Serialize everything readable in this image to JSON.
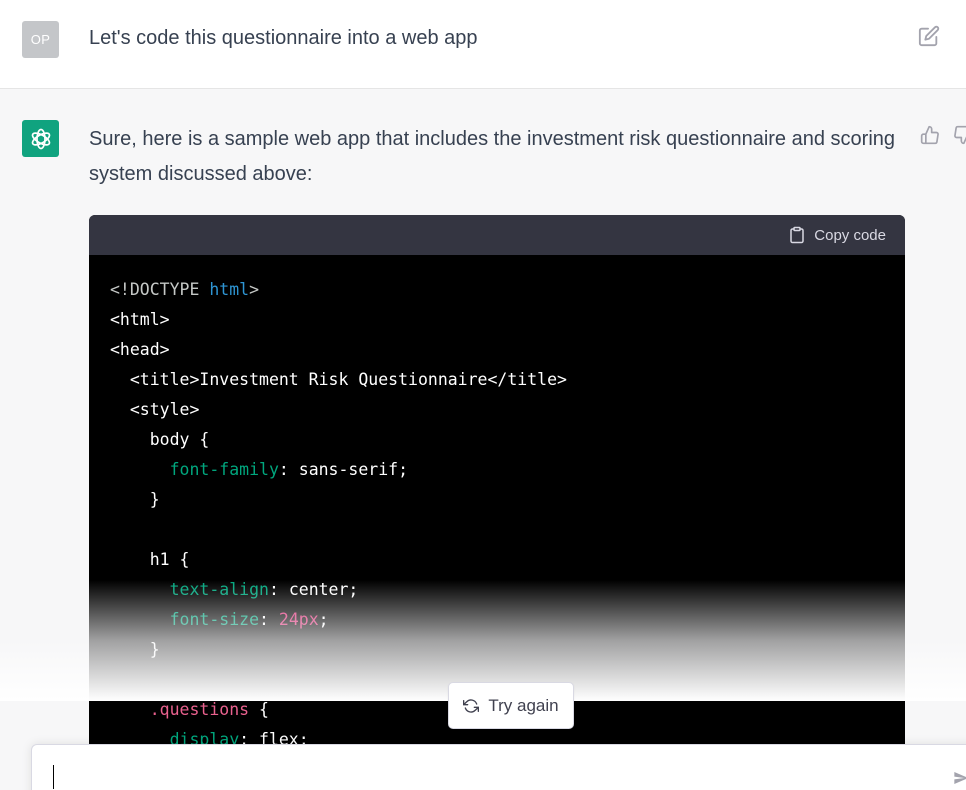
{
  "user_message": {
    "avatar_initials": "OP",
    "text": "Let's code this questionnaire into a web app"
  },
  "assistant_message": {
    "text": "Sure, here is a sample web app that includes the investment risk questionnaire and scoring system discussed above:",
    "code_block": {
      "copy_label": "Copy code",
      "lines": {
        "l1_a": "<!DOCTYPE ",
        "l1_b": "html",
        "l1_c": ">",
        "l2": "<html>",
        "l3": "<head>",
        "l4": "  <title>Investment Risk Questionnaire</title>",
        "l5": "  <style>",
        "l6": "    body {",
        "l7_a": "      font-family",
        "l7_b": ": sans-serif;",
        "l8": "    }",
        "l9": "",
        "l10": "    h1 {",
        "l11_a": "      text-align",
        "l11_b": ": center;",
        "l12_a": "      font-size",
        "l12_b": ": ",
        "l12_c": "24px",
        "l12_d": ";",
        "l13": "    }",
        "l14": "",
        "l15_a": "    .questions",
        "l15_b": " {",
        "l16_a": "      display",
        "l16_b": ": flex;"
      }
    }
  },
  "actions": {
    "try_again_label": "Try again"
  },
  "composer": {
    "value": ""
  },
  "colors": {
    "brand": "#10a37f",
    "code_bg": "#000000",
    "code_header_bg": "#343541",
    "user_avatar": "#c4c6c9"
  }
}
